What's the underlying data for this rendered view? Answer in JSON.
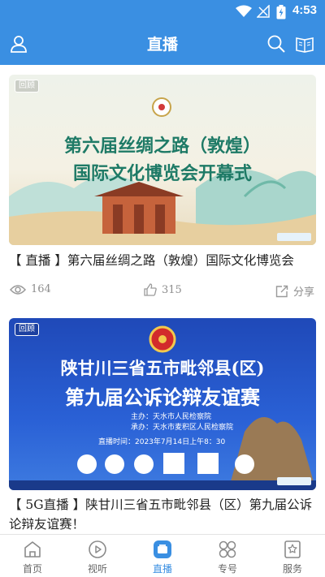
{
  "status_bar": {
    "time": "4:53"
  },
  "header": {
    "title": "直播"
  },
  "colors": {
    "accent": "#3a8fe2",
    "text": "#222222",
    "muted": "#8d8d8d"
  },
  "cards": [
    {
      "badge": "回顾",
      "poster_lines": [
        "第六届丝绸之路（敦煌）",
        "国际文化博览会开幕式"
      ],
      "title": "【 直播 】第六届丝绸之路（敦煌）国际文化博览会",
      "views": "164",
      "likes": "315",
      "share_label": "分享"
    },
    {
      "badge": "回顾",
      "poster_lines": [
        "陕甘川三省五市毗邻县(区)",
        "第九届公诉论辩友谊赛"
      ],
      "poster_small": [
        "主办：天水市人民检察院",
        "承办：天水市麦积区人民检察院",
        "直播时间：2023年7月14日上午8：30"
      ],
      "title": "【 5G直播 】陕甘川三省五市毗邻县（区）第九届公诉论辩友谊赛！"
    }
  ],
  "tabs": [
    {
      "label": "首页",
      "icon": "home-icon"
    },
    {
      "label": "视听",
      "icon": "play-icon"
    },
    {
      "label": "直播",
      "icon": "live-icon",
      "active": true
    },
    {
      "label": "专号",
      "icon": "grid-icon"
    },
    {
      "label": "服务",
      "icon": "service-icon"
    }
  ]
}
